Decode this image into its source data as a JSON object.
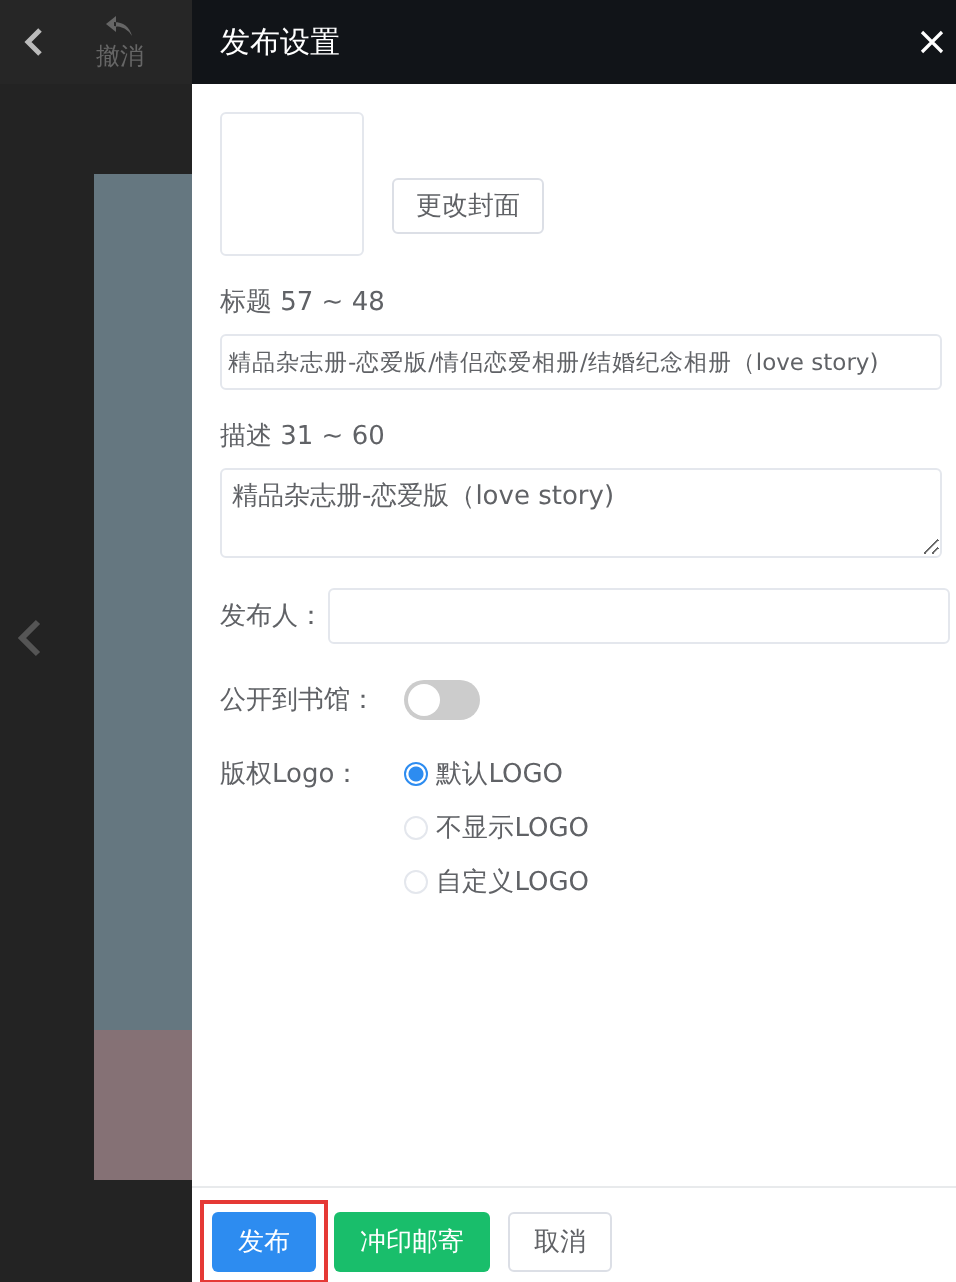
{
  "editor": {
    "undo_label": "撤消"
  },
  "drawer": {
    "title": "发布设置",
    "cover": {
      "button": "更改封面"
    },
    "title_field": {
      "label": "标题 57 ~ 48",
      "value": "精品杂志册-恋爱版/情侣恋爱相册/结婚纪念相册（love story)"
    },
    "description_field": {
      "label": "描述 31 ~ 60",
      "value": "精品杂志册-恋爱版（love story)"
    },
    "publisher_field": {
      "label": "发布人："
    },
    "public_toggle": {
      "label": "公开到书馆：",
      "on": false
    },
    "logo_options": {
      "label": "版权Logo：",
      "options": [
        {
          "label": "默认LOGO",
          "selected": true
        },
        {
          "label": "不显示LOGO",
          "selected": false
        },
        {
          "label": "自定义LOGO",
          "selected": false
        }
      ]
    },
    "buttons": [
      {
        "label": "发布",
        "kind": "primary",
        "highlighted": true
      },
      {
        "label": "冲印邮寄",
        "kind": "success",
        "highlighted": false
      },
      {
        "label": "取消",
        "kind": "default",
        "highlighted": false
      }
    ]
  }
}
